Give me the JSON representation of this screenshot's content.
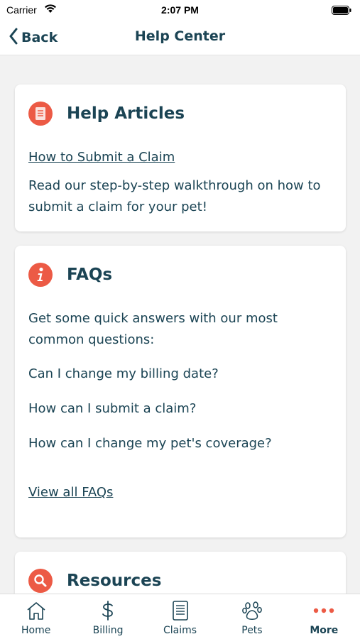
{
  "status_bar": {
    "carrier": "Carrier",
    "time": "2:07 PM"
  },
  "nav": {
    "back_label": "Back",
    "title": "Help Center"
  },
  "help_articles": {
    "title": "Help Articles",
    "icon": "document-icon",
    "link_text": "How to Submit a Claim",
    "description": "Read our step-by-step walkthrough on how to submit a claim for your pet!"
  },
  "faqs": {
    "title": "FAQs",
    "icon": "info-icon",
    "intro": "Get some quick answers with our most common questions:",
    "questions": [
      "Can I change my billing date?",
      "How can I submit a claim?",
      "How can I change my pet's coverage?"
    ],
    "view_all": "View all FAQs"
  },
  "resources": {
    "title": "Resources",
    "icon": "search-icon"
  },
  "tabs": [
    {
      "label": "Home",
      "icon": "home-icon"
    },
    {
      "label": "Billing",
      "icon": "dollar-icon"
    },
    {
      "label": "Claims",
      "icon": "claims-document-icon"
    },
    {
      "label": "Pets",
      "icon": "paw-icon"
    },
    {
      "label": "More",
      "icon": "more-dots-icon",
      "active": true
    }
  ],
  "colors": {
    "primary_text": "#1b4454",
    "accent": "#ec5a45",
    "background": "#f2f2f2"
  }
}
